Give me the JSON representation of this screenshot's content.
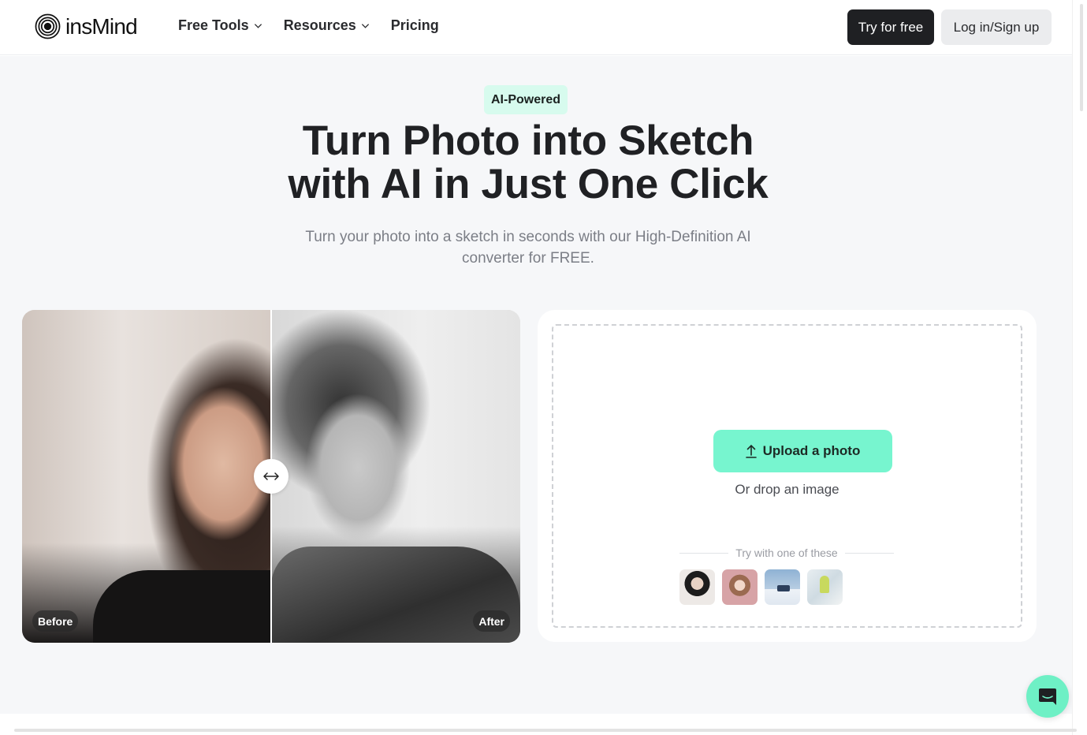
{
  "header": {
    "logo_text": "insMind",
    "nav": [
      {
        "label": "Free Tools",
        "has_dropdown": true
      },
      {
        "label": "Resources",
        "has_dropdown": true
      },
      {
        "label": "Pricing",
        "has_dropdown": false
      }
    ],
    "try_label": "Try for free",
    "login_label": "Log in/Sign up"
  },
  "hero": {
    "badge": "AI-Powered",
    "title_line1": "Turn Photo into Sketch",
    "title_line2": "with AI in Just One Click",
    "subtitle": "Turn your photo into a sketch in seconds with our High-Definition AI converter for FREE."
  },
  "compare": {
    "before_label": "Before",
    "after_label": "After",
    "handle_icon": "left-right-arrow-icon"
  },
  "upload": {
    "button_label": "Upload a photo",
    "button_icon": "upload-icon",
    "drop_text": "Or drop an image",
    "try_text": "Try with one of these",
    "samples": [
      "portrait-woman-dark",
      "portrait-girl-pink",
      "snow-house",
      "flowers-window"
    ]
  },
  "colors": {
    "accent": "#77f5cf",
    "badge_bg": "#d7fbee",
    "dark_button": "#1f2023",
    "light_button": "#ebecee",
    "hero_bg": "#f6f7f9"
  },
  "chat": {
    "icon": "chat-bubble-icon"
  }
}
